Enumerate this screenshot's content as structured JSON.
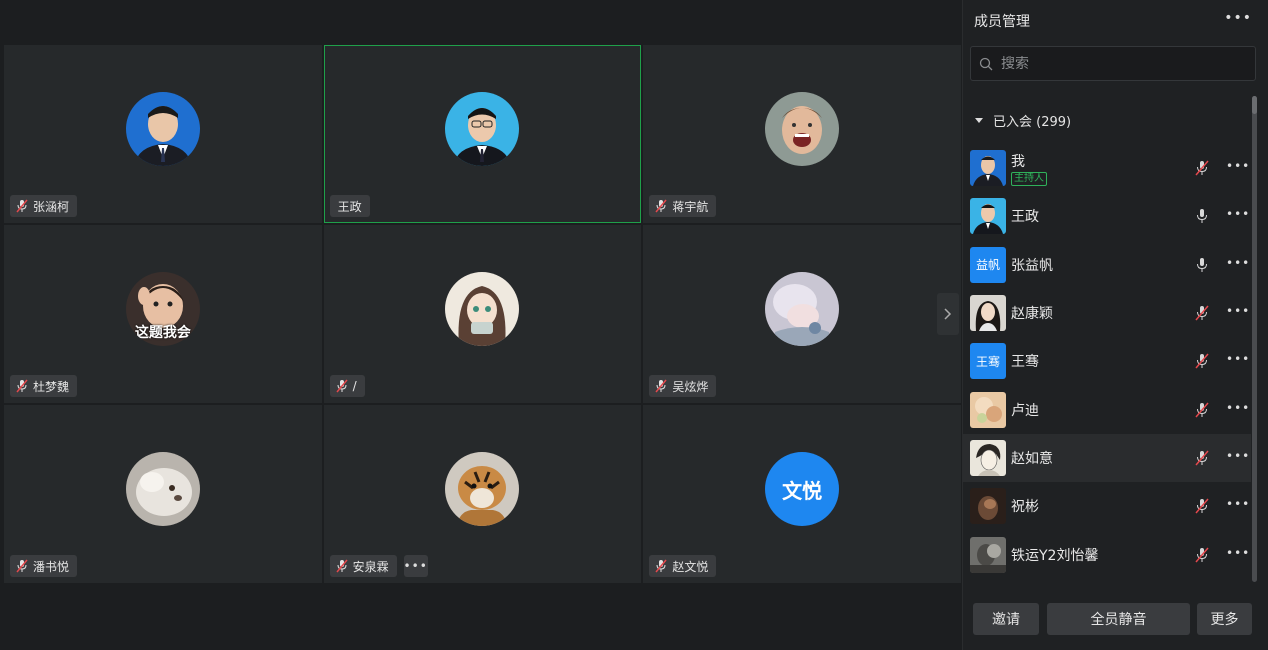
{
  "colors": {
    "accent_blue": "#1e87f0",
    "host_green": "#2fb15a",
    "speaking_border": "#1fa04a",
    "muted_red": "#e5484d"
  },
  "grid": {
    "tiles": [
      {
        "name": "张涵柯",
        "muted": true,
        "avatar": "photo-man-suit-blue"
      },
      {
        "name": "王政",
        "muted": false,
        "speaking": true,
        "avatar": "photo-man-glasses-suit"
      },
      {
        "name": "蒋宇航",
        "muted": true,
        "avatar": "photo-laughing-child"
      },
      {
        "name": "杜梦魏",
        "muted": true,
        "avatar": "photo-child-meme",
        "avatar_caption": "这题我会"
      },
      {
        "name": "/",
        "muted": true,
        "avatar": "anime-girl"
      },
      {
        "name": "吴炫烨",
        "muted": true,
        "avatar": "anime-sleeping"
      },
      {
        "name": "潘书悦",
        "muted": true,
        "avatar": "photo-seal"
      },
      {
        "name": "安泉霖",
        "muted": true,
        "avatar": "photo-tiger",
        "has_more": true
      },
      {
        "name": "赵文悦",
        "muted": true,
        "avatar_text": "文悦"
      }
    ],
    "next_page_icon": "chevron-right-icon"
  },
  "panel": {
    "title": "成员管理",
    "search_placeholder": "搜索",
    "section_label": "已入会 (299)",
    "members": [
      {
        "name": "我",
        "badge": "主持人",
        "mic": "muted",
        "avatar": "photo-man-suit-blue"
      },
      {
        "name": "王政",
        "mic": "on",
        "avatar": "photo-man-glasses-suit"
      },
      {
        "name": "张益帆",
        "mic": "on",
        "avatar_text": "益帆"
      },
      {
        "name": "赵康颖",
        "mic": "muted",
        "avatar": "photo-girl"
      },
      {
        "name": "王骞",
        "mic": "muted",
        "avatar_text": "王骞"
      },
      {
        "name": "卢迪",
        "mic": "muted",
        "avatar": "photo-pastel"
      },
      {
        "name": "赵如意",
        "mic": "muted",
        "avatar": "anime-sketch",
        "hover": true
      },
      {
        "name": "祝彬",
        "mic": "muted",
        "avatar": "photo-dark"
      },
      {
        "name": "铁运Y2刘怡馨",
        "mic": "muted",
        "avatar": "photo-grey"
      }
    ],
    "buttons": {
      "invite": "邀请",
      "mute_all": "全员静音",
      "more": "更多"
    }
  }
}
